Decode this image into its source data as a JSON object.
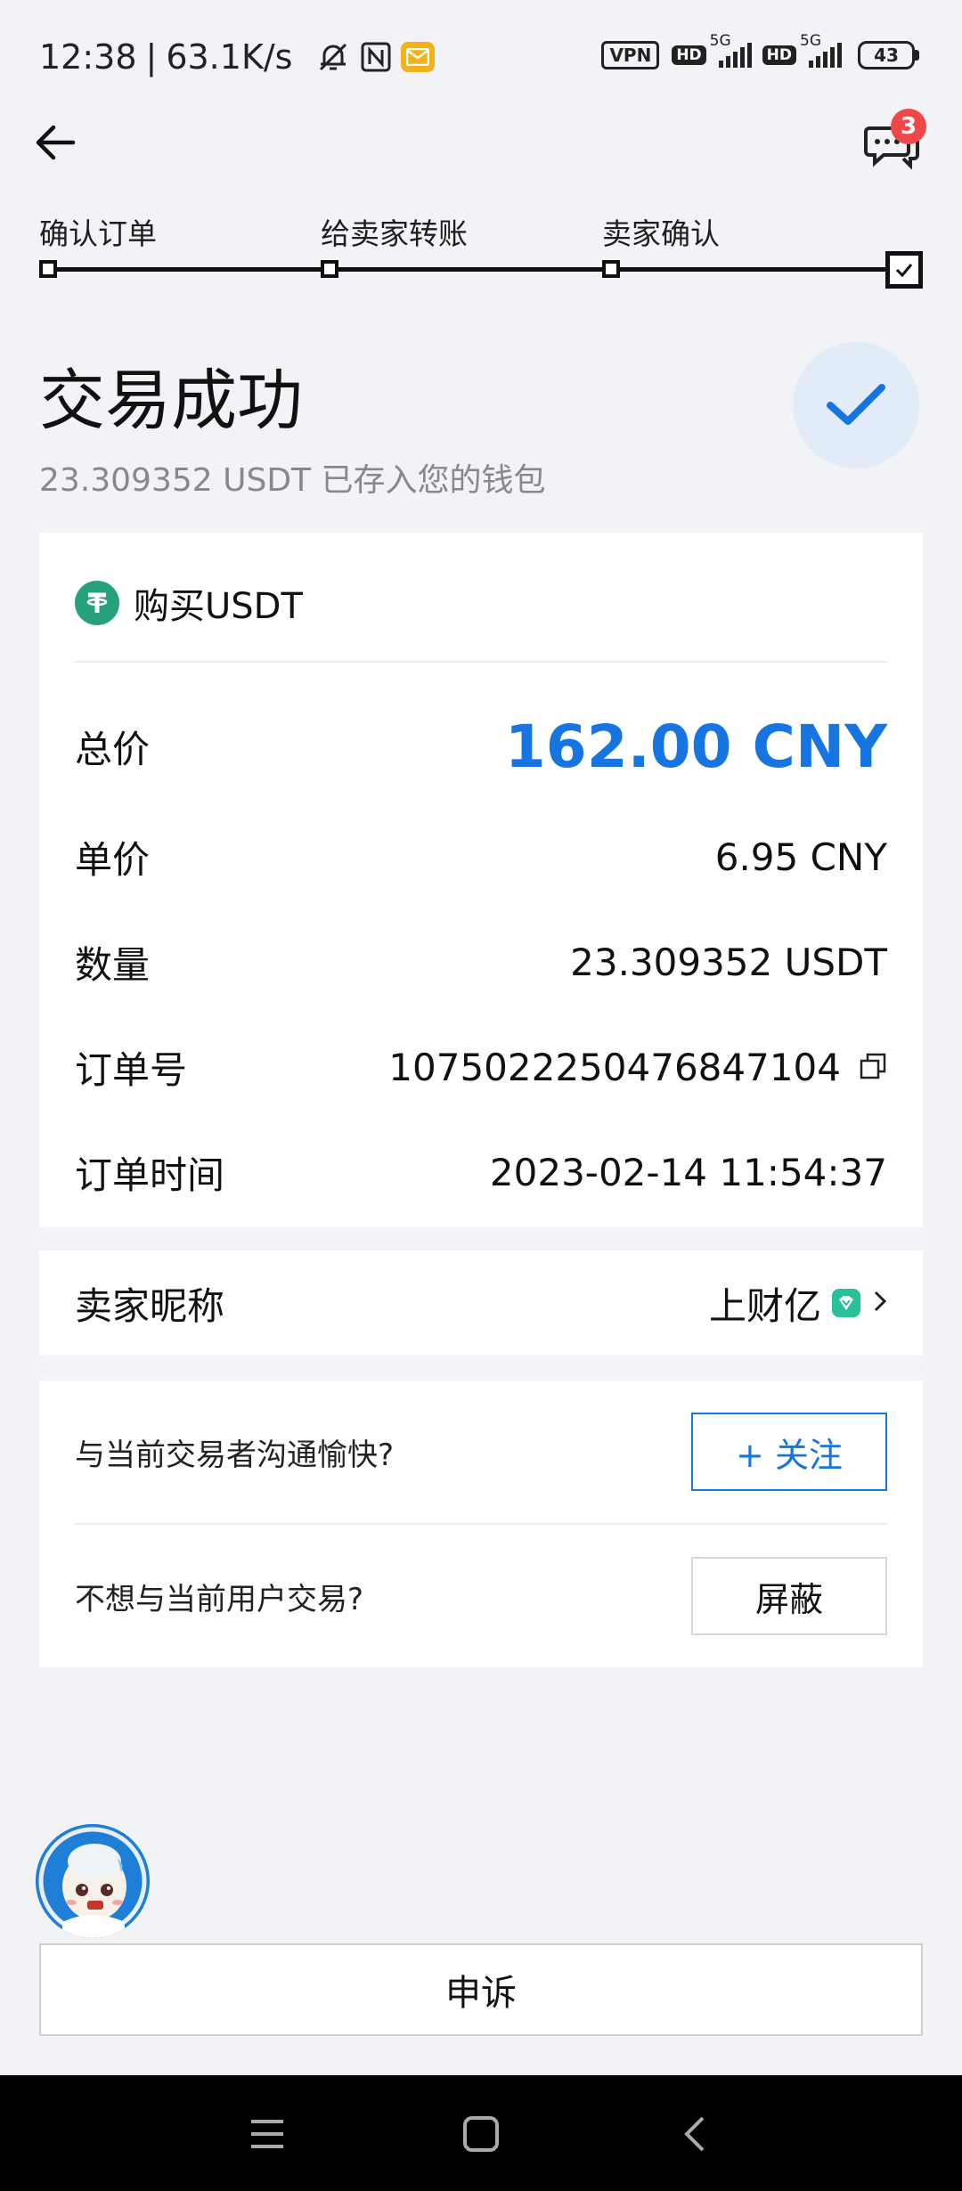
{
  "status_bar": {
    "time": "12:38",
    "speed": "63.1K/s",
    "vpn": "VPN",
    "sim1": {
      "hd": "HD",
      "net": "5G"
    },
    "sim2": {
      "hd": "HD",
      "net": "5G"
    },
    "battery": "43"
  },
  "header": {
    "message_count": "3"
  },
  "progress": {
    "steps": [
      "确认订单",
      "给卖家转账",
      "卖家确认"
    ]
  },
  "result": {
    "title": "交易成功",
    "subtitle": "23.309352 USDT 已存入您的钱包"
  },
  "order": {
    "coin_title": "购买USDT",
    "total_label": "总价",
    "total_value": "162.00 CNY",
    "unit_price_label": "单价",
    "unit_price_value": "6.95 CNY",
    "quantity_label": "数量",
    "quantity_value": "23.309352 USDT",
    "order_no_label": "订单号",
    "order_no_value": "1075022250476847104",
    "order_time_label": "订单时间",
    "order_time_value": "2023-02-14 11:54:37"
  },
  "seller": {
    "label": "卖家昵称",
    "name": "上财亿"
  },
  "actions": {
    "follow_prompt": "与当前交易者沟通愉快?",
    "follow_button": "+ 关注",
    "block_prompt": "不想与当前用户交易?",
    "block_button": "屏蔽"
  },
  "footer": {
    "appeal_button": "申诉"
  },
  "colors": {
    "accent": "#1675e0",
    "tether": "#26a17b",
    "badge": "#f0474a",
    "background": "#f1f3f7"
  }
}
